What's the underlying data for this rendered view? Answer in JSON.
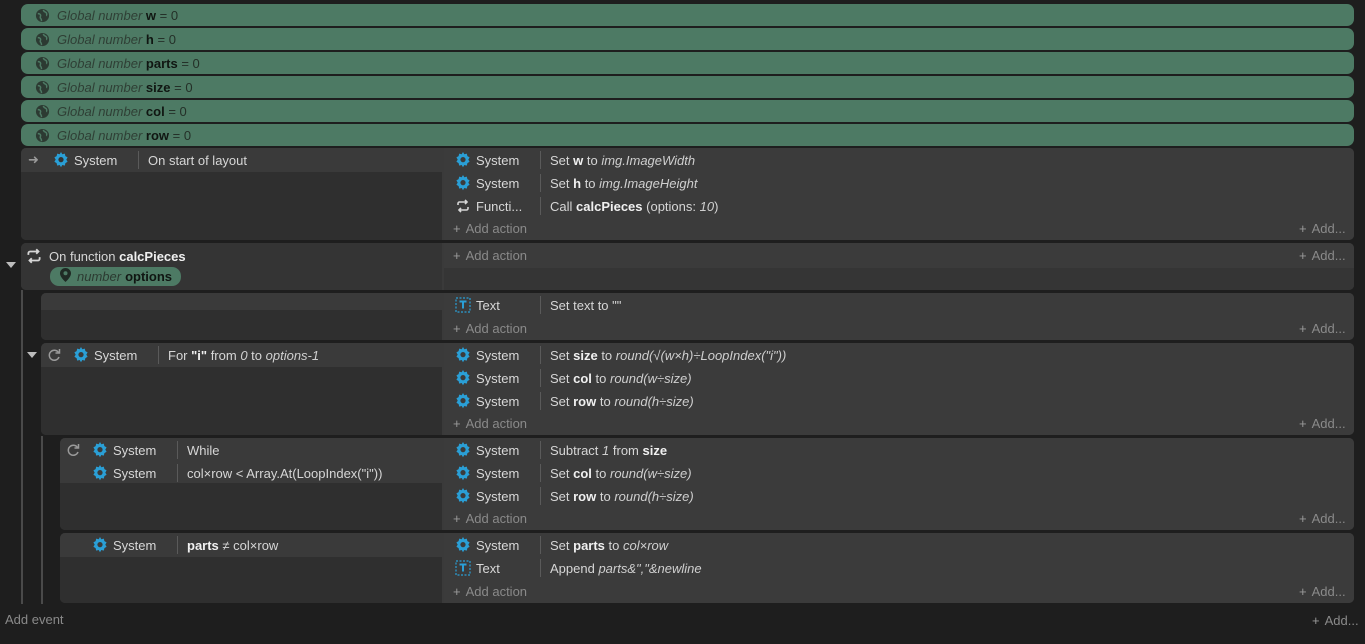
{
  "globals": [
    {
      "prefix": "Global number",
      "name": "w",
      "suffix": "= 0"
    },
    {
      "prefix": "Global number",
      "name": "h",
      "suffix": "= 0"
    },
    {
      "prefix": "Global number",
      "name": "parts",
      "suffix": "= 0"
    },
    {
      "prefix": "Global number",
      "name": "size",
      "suffix": "= 0"
    },
    {
      "prefix": "Global number",
      "name": "col",
      "suffix": "= 0"
    },
    {
      "prefix": "Global number",
      "name": "row",
      "suffix": "= 0"
    }
  ],
  "labels": {
    "add_action": "Add action",
    "add": "Add...",
    "add_event": "Add event"
  },
  "ev1": {
    "cond": {
      "object": "System",
      "text": "On start of layout"
    },
    "actions": [
      {
        "object": "System",
        "a": "Set ",
        "b": "w",
        "c": " to ",
        "i": "img.ImageWidth",
        "d": ""
      },
      {
        "object": "System",
        "a": "Set ",
        "b": "h",
        "c": " to ",
        "i": "img.ImageHeight",
        "d": ""
      },
      {
        "object": "Functi...",
        "a": "Call ",
        "b": "calcPieces",
        "c": " (options: ",
        "i": "10",
        "d": ")"
      }
    ]
  },
  "func": {
    "prefix": "On function ",
    "name": "calcPieces",
    "param_type": "number",
    "param_name": "options"
  },
  "ev_text": {
    "actions": [
      {
        "object": "Text",
        "text": "Set text to \"\""
      }
    ]
  },
  "ev_for": {
    "cond": {
      "object": "System",
      "pre": "For ",
      "q": "\"i\"",
      "mid": " from ",
      "from": "0",
      "to_label": " to ",
      "to": "options-1"
    },
    "actions": [
      {
        "object": "System",
        "a": "Set ",
        "b": "size",
        "c": " to ",
        "i": "round(√(w×h)÷LoopIndex(\"i\"))",
        "d": ""
      },
      {
        "object": "System",
        "a": "Set ",
        "b": "col",
        "c": " to ",
        "i": "round(w÷size)",
        "d": ""
      },
      {
        "object": "System",
        "a": "Set ",
        "b": "row",
        "c": " to ",
        "i": "round(h÷size)",
        "d": ""
      }
    ]
  },
  "ev_while": {
    "conds": [
      {
        "object": "System",
        "text": "While"
      },
      {
        "object": "System",
        "text": "col×row < Array.At(LoopIndex(\"i\"))"
      }
    ],
    "actions": [
      {
        "object": "System",
        "a": "Subtract ",
        "b": "",
        "c": "",
        "i": "1",
        "d": " from ",
        "e": "size"
      },
      {
        "object": "System",
        "a": "Set ",
        "b": "col",
        "c": " to ",
        "i": "round(w÷size)",
        "d": "",
        "e": ""
      },
      {
        "object": "System",
        "a": "Set ",
        "b": "row",
        "c": " to ",
        "i": "round(h÷size)",
        "d": "",
        "e": ""
      }
    ]
  },
  "ev_parts": {
    "cond": {
      "object": "System",
      "b": "parts",
      "rest": " ≠ col×row"
    },
    "actions": [
      {
        "object": "System",
        "a": "Set ",
        "b": "parts",
        "c": " to ",
        "i": "col×row",
        "d": ""
      },
      {
        "object": "Text",
        "a": "Append ",
        "b": "",
        "c": "",
        "i": "parts&\",\"&newline",
        "d": ""
      }
    ]
  }
}
